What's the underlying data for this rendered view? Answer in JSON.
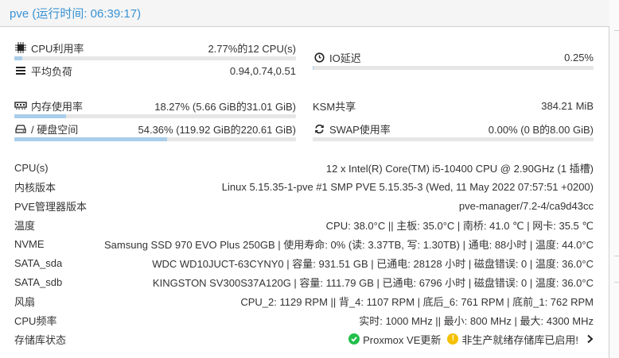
{
  "header": {
    "title": "pve (运行时间: 06:39:17)"
  },
  "left_metrics": [
    {
      "label": "CPU利用率",
      "value": "2.77%的12 CPU(s)",
      "icon": "cpu-icon",
      "fraction": 0.0277
    },
    {
      "label": "平均负荷",
      "value": "0.94,0.74,0.51",
      "icon": "load-icon"
    },
    {
      "label": "内存使用率",
      "value": "18.27% (5.66 GiB的31.01 GiB)",
      "icon": "memory-icon",
      "fraction": 0.1827
    },
    {
      "label": "/ 硬盘空间",
      "value": "54.36% (119.92 GiB的220.61 GiB)",
      "icon": "disk-icon",
      "fraction": 0.5436
    }
  ],
  "right_metrics": [
    {
      "label": "IO延迟",
      "value": "0.25%",
      "icon": "clock-icon",
      "fraction": 0.0025
    },
    {
      "label": "KSM共享",
      "value": "384.21 MiB"
    },
    {
      "label": "SWAP使用率",
      "value": "0.00% (0 B的8.00 GiB)",
      "icon": "refresh-icon",
      "fraction": 0.0
    }
  ],
  "info_rows": [
    {
      "key": "CPU(s)",
      "value": "12 x Intel(R) Core(TM) i5-10400 CPU @ 2.90GHz (1 插槽)"
    },
    {
      "key": "内核版本",
      "value": "Linux 5.15.35-1-pve #1 SMP PVE 5.15.35-3 (Wed, 11 May 2022 07:57:51 +0200)"
    },
    {
      "key": "PVE管理器版本",
      "value": "pve-manager/7.2-4/ca9d43cc"
    },
    {
      "key": "温度",
      "value": "CPU: 38.0°C || 主板: 35.0°C | 南桥: 41.0 ℃ | 网卡: 35.5 ℃"
    },
    {
      "key": "NVME",
      "value": "Samsung SSD 970 EVO Plus 250GB | 使用寿命: 0% (读: 3.37TB, 写: 1.30TB) | 通电: 88小时 | 温度: 44.0°C"
    },
    {
      "key": "SATA_sda",
      "value": "WDC WD10JUCT-63CYNY0 | 容量: 931.51 GB | 已通电: 28128 小时 | 磁盘错误: 0 | 温度: 36.0°C"
    },
    {
      "key": "SATA_sdb",
      "value": "KINGSTON SV300S37A120G | 容量: 111.79 GB | 已通电: 6796 小时 | 磁盘错误: 0 | 温度: 36.0°C"
    },
    {
      "key": "风扇",
      "value": "CPU_2: 1129 RPM || 背_4: 1107 RPM | 底后_6: 761 RPM | 底前_1: 762 RPM"
    },
    {
      "key": "CPU频率",
      "value": "实时: 1000 MHz || 最小: 800 MHz | 最大: 4300 MHz"
    }
  ],
  "storage": {
    "key": "存储库状态",
    "ok_text": "Proxmox VE更新",
    "warn_text": "非生产就绪存储库已启用!",
    "colors": {
      "ok": "#21bf4b",
      "warn": "#f5c000",
      "accent": "#3892d4",
      "bar_fill": "#a9cdea"
    }
  }
}
